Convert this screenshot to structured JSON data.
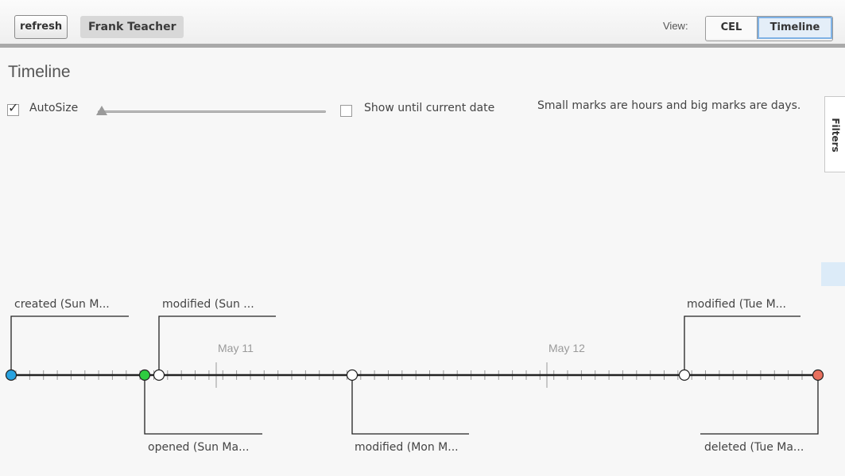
{
  "toolbar": {
    "refresh_label": "refresh",
    "user_name": "Frank Teacher",
    "view_label": "View:",
    "view_options": [
      "CEL",
      "Timeline"
    ],
    "selected_view": "Timeline"
  },
  "page": {
    "title": "Timeline",
    "autosize_label": "AutoSize",
    "autosize_checked": true,
    "show_until_label": "Show until current date",
    "show_until_checked": false,
    "hint": "Small marks are hours and big marks are days.",
    "filters_tab": "Filters"
  },
  "timeline": {
    "day_labels": [
      "May 11",
      "May 12"
    ],
    "events": [
      {
        "label": "created (Sun M...",
        "type": "created",
        "color": "#29a3e0"
      },
      {
        "label": "opened (Sun Ma...",
        "type": "opened",
        "color": "#2ecc40"
      },
      {
        "label": "modified (Sun ...",
        "type": "modified",
        "color": "#ffffff"
      },
      {
        "label": "modified (Mon M...",
        "type": "modified",
        "color": "#ffffff"
      },
      {
        "label": "modified (Tue M...",
        "type": "modified",
        "color": "#ffffff"
      },
      {
        "label": "deleted (Tue Ma...",
        "type": "deleted",
        "color": "#e8705e"
      }
    ]
  }
}
